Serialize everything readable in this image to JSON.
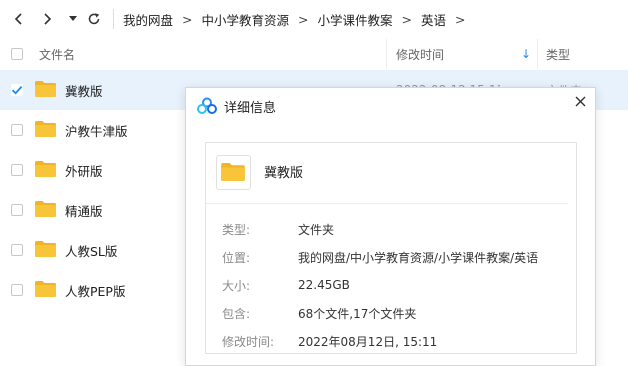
{
  "nav": {
    "breadcrumbs": [
      "我的网盘",
      "中小学教育资源",
      "小学课件教案",
      "英语"
    ],
    "separator": ">"
  },
  "header": {
    "filename_col": "文件名",
    "modified_col": "修改时间",
    "type_col": "类型",
    "sort_indicator": "↓"
  },
  "rows": [
    {
      "name": "冀教版",
      "selected": true,
      "modified_partial": "2022-08-12 15:11",
      "type_partial": "文件夹"
    },
    {
      "name": "沪教牛津版",
      "selected": false
    },
    {
      "name": "外研版",
      "selected": false
    },
    {
      "name": "精通版",
      "selected": false
    },
    {
      "name": "人教SL版",
      "selected": false
    },
    {
      "name": "人教PEP版",
      "selected": false
    }
  ],
  "dialog": {
    "title": "详细信息",
    "item_name": "冀教版",
    "props": [
      {
        "label": "类型:",
        "value": "文件夹"
      },
      {
        "label": "位置:",
        "value": "我的网盘/中小学教育资源/小学课件教案/英语"
      },
      {
        "label": "大小:",
        "value": "22.45GB"
      },
      {
        "label": "包含:",
        "value": "68个文件,17个文件夹"
      },
      {
        "label": "修改时间:",
        "value": "2022年08月12日, 15:11"
      }
    ]
  },
  "colors": {
    "folder": "#f7c43a",
    "folder_back": "#f0b429",
    "accent": "#1a8cf0",
    "selected_row": "#e8f2fd"
  }
}
